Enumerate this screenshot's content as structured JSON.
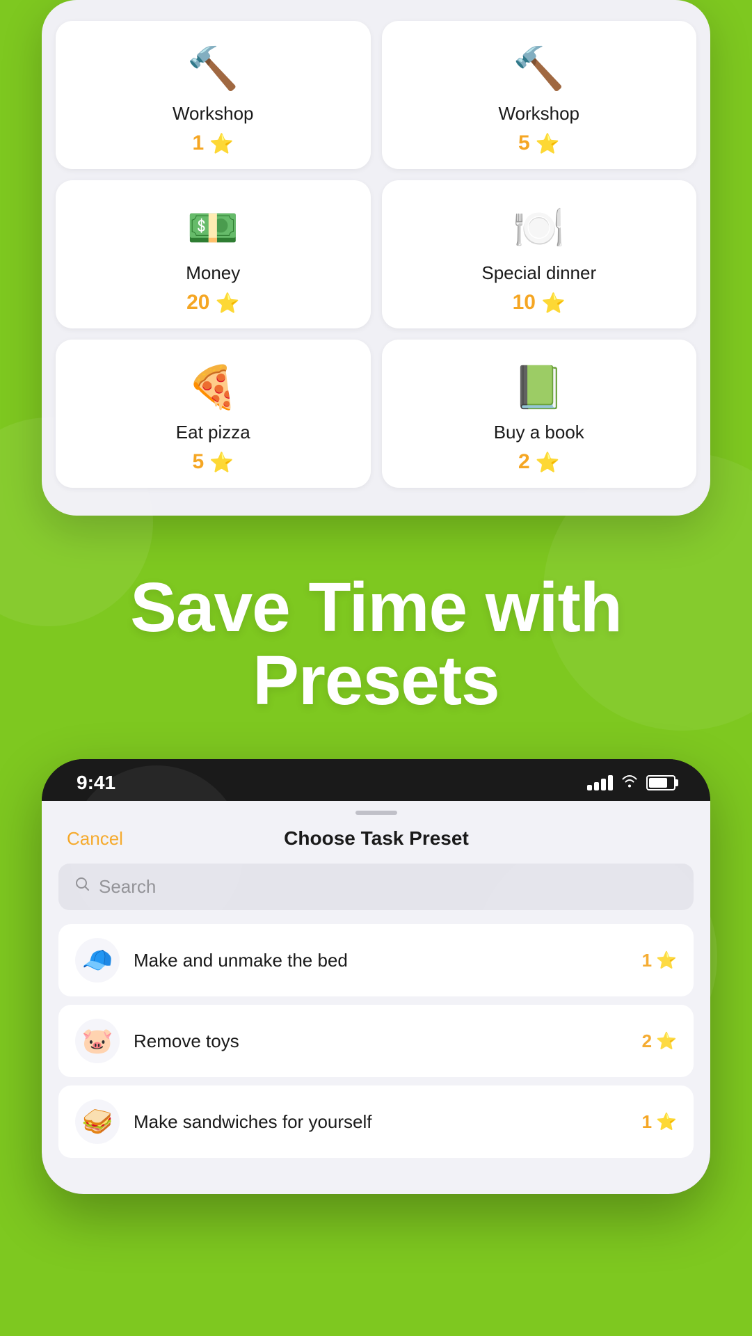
{
  "topCard": {
    "rewards": [
      {
        "id": "workshop1",
        "name": "Workshop",
        "points": "1",
        "icon": "🔨",
        "iconAlt": "workshop-icon"
      },
      {
        "id": "workshop5",
        "name": "Workshop",
        "points": "5",
        "icon": "🔨",
        "iconAlt": "workshop-icon"
      },
      {
        "id": "money20",
        "name": "Money",
        "points": "20",
        "icon": "💵",
        "iconAlt": "money-icon"
      },
      {
        "id": "specialdinner10",
        "name": "Special dinner",
        "points": "10",
        "icon": "🍽️",
        "iconAlt": "special-dinner-icon"
      },
      {
        "id": "eatpizza5",
        "name": "Eat pizza",
        "points": "5",
        "icon": "🍕",
        "iconAlt": "eat-pizza-icon"
      },
      {
        "id": "buyabook2",
        "name": "Buy a book",
        "points": "2",
        "icon": "📗",
        "iconAlt": "buy-a-book-icon"
      }
    ]
  },
  "headline": {
    "line1": "Save Time with",
    "line2": "Presets"
  },
  "bottomPhone": {
    "statusBar": {
      "time": "9:41"
    },
    "sheet": {
      "cancelLabel": "Cancel",
      "title": "Choose Task Preset",
      "searchPlaceholder": "Search"
    },
    "tasks": [
      {
        "id": "task1",
        "name": "Make and unmake the bed",
        "points": "1",
        "icon": "🧢",
        "iconAlt": "bed-task-icon"
      },
      {
        "id": "task2",
        "name": "Remove toys",
        "points": "2",
        "icon": "🐷",
        "iconAlt": "remove-toys-icon"
      },
      {
        "id": "task3",
        "name": "Make sandwiches for yourself",
        "points": "1",
        "icon": "🥪",
        "iconAlt": "sandwiches-icon"
      }
    ]
  },
  "colors": {
    "background": "#7ec820",
    "accent": "#f5a623",
    "cancel": "#f5a623"
  }
}
